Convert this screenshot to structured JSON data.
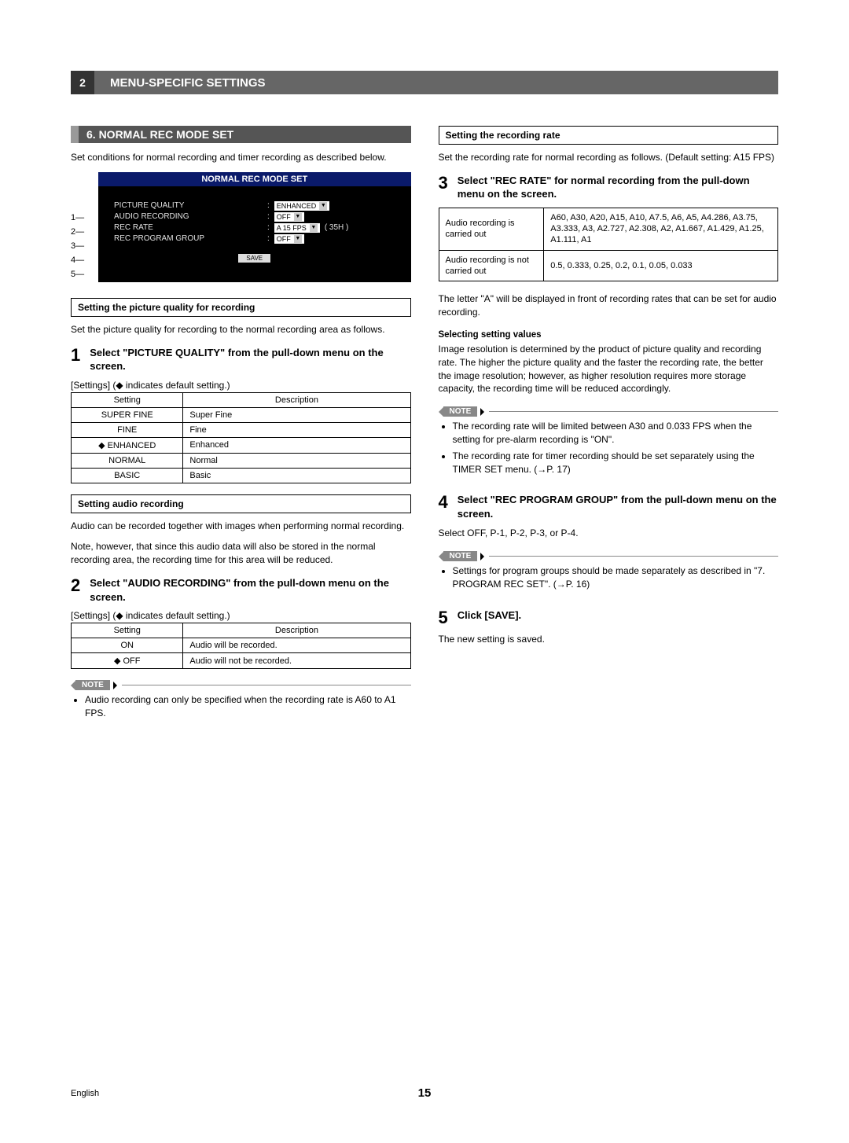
{
  "header": {
    "chapter_number": "2",
    "chapter_title": "MENU-SPECIFIC SETTINGS"
  },
  "left": {
    "section_title": "6. NORMAL REC MODE SET",
    "intro": "Set conditions for normal recording and timer recording as described below.",
    "gui": {
      "panel_title": "NORMAL REC MODE SET",
      "callouts": [
        "1",
        "2",
        "3",
        "4",
        "5"
      ],
      "rows": {
        "picture_quality_label": "PICTURE QUALITY",
        "picture_quality_value": "ENHANCED",
        "audio_recording_label": "AUDIO RECORDING",
        "audio_recording_value": "OFF",
        "rec_rate_label": "REC RATE",
        "rec_rate_value": "A 15 FPS",
        "rec_rate_hours": "( 35H )",
        "rec_program_label": "REC PROGRAM GROUP",
        "rec_program_value": "OFF",
        "save_label": "SAVE"
      }
    },
    "sub1_heading": "Setting the picture quality for recording",
    "sub1_text": "Set the picture quality for recording to the normal recording area as follows.",
    "step1_num": "1",
    "step1_text": "Select \"PICTURE QUALITY\" from the pull-down menu on the screen.",
    "settings_caption": "[Settings] (◆ indicates default setting.)",
    "table1": {
      "headers": [
        "Setting",
        "Description"
      ],
      "rows": [
        [
          "SUPER FINE",
          "Super Fine"
        ],
        [
          "FINE",
          "Fine"
        ],
        [
          "◆ ENHANCED",
          "Enhanced"
        ],
        [
          "NORMAL",
          "Normal"
        ],
        [
          "BASIC",
          "Basic"
        ]
      ]
    },
    "sub2_heading": "Setting audio recording",
    "sub2_text1": "Audio can be recorded together with images when performing normal recording.",
    "sub2_text2": "Note, however, that since this audio data will also be stored in the normal recording area, the recording time for this area will be reduced.",
    "step2_num": "2",
    "step2_text": "Select \"AUDIO RECORDING\" from the pull-down menu on the screen.",
    "table2": {
      "headers": [
        "Setting",
        "Description"
      ],
      "rows": [
        [
          "ON",
          "Audio will be recorded."
        ],
        [
          "◆ OFF",
          "Audio will not be recorded."
        ]
      ]
    },
    "note_label": "NOTE",
    "note1_items": [
      "Audio recording can only be specified when the recording rate is A60 to A1 FPS."
    ]
  },
  "right": {
    "sub3_heading": "Setting the recording rate",
    "sub3_text": "Set the recording rate for normal recording as follows. (Default setting: A15 FPS)",
    "step3_num": "3",
    "step3_text": "Select \"REC RATE\" for normal recording from the pull-down menu on the screen.",
    "rate_table": [
      [
        "Audio recording is carried out",
        "A60, A30, A20, A15, A10, A7.5, A6, A5, A4.286, A3.75, A3.333, A3, A2.727, A2.308, A2, A1.667, A1.429, A1.25, A1.111, A1"
      ],
      [
        "Audio recording is not carried out",
        "0.5, 0.333, 0.25, 0.2, 0.1, 0.05, 0.033"
      ]
    ],
    "letter_a_note": "The letter \"A\" will be displayed in front of recording rates that can be set for audio recording.",
    "selecting_heading": "Selecting setting values",
    "selecting_text": "Image resolution is determined by the product of picture quality and recording rate. The higher the picture quality and the faster the recording rate, the better the image resolution; however, as higher resolution requires more storage capacity, the recording time will be reduced accordingly.",
    "note2_items": [
      "The recording rate will be limited between A30 and 0.033 FPS when the setting for pre-alarm recording is \"ON\".",
      "The recording rate for timer recording should be set separately using the TIMER SET menu. (→P. 17)"
    ],
    "step4_num": "4",
    "step4_text": "Select \"REC PROGRAM GROUP\" from the pull-down menu on the screen.",
    "step4_body": "Select OFF, P-1, P-2, P-3, or P-4.",
    "note3_items": [
      "Settings for program groups should be made separately as described in \"7. PROGRAM REC SET\". (→P. 16)"
    ],
    "step5_num": "5",
    "step5_text": "Click [SAVE].",
    "step5_body": "The new setting is saved."
  },
  "footer": {
    "language": "English",
    "page": "15"
  }
}
